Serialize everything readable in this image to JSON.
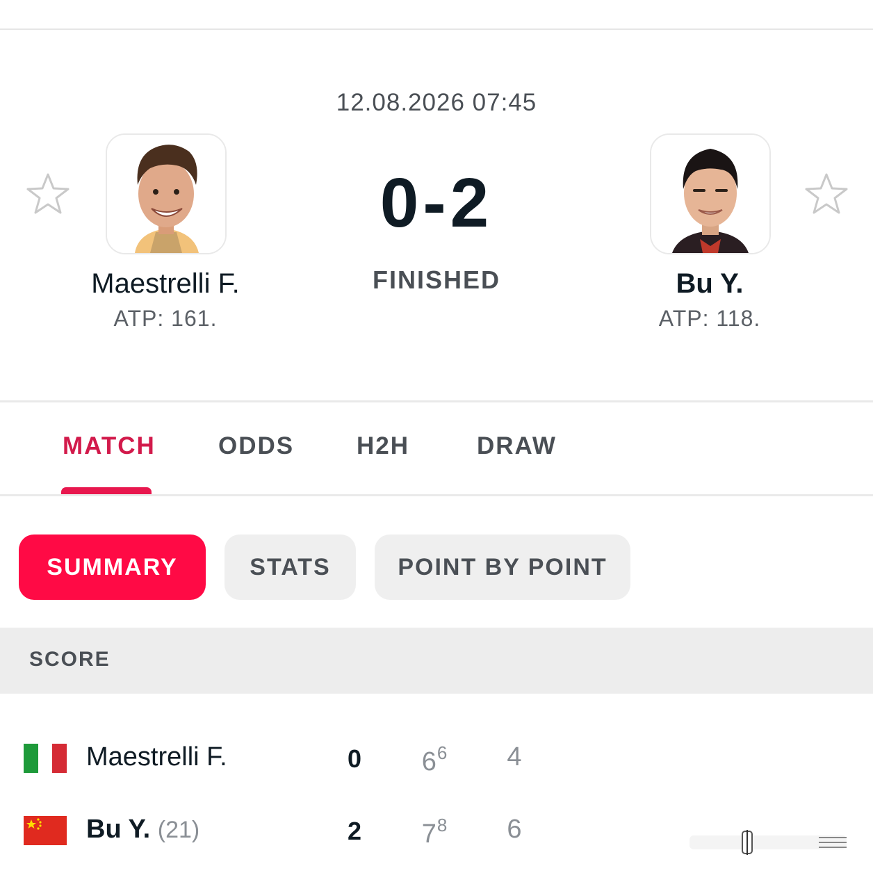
{
  "header": {
    "date_time": "12.08.2026 07:45",
    "score": "0-2",
    "status": "FINISHED"
  },
  "home_player": {
    "name": "Maestrelli F.",
    "rank": "ATP: 161.",
    "favorite_icon": "star-outline-icon"
  },
  "away_player": {
    "name": "Bu Y.",
    "rank": "ATP: 118.",
    "favorite_icon": "star-outline-icon"
  },
  "tabs": [
    {
      "label": "MATCH",
      "active": true
    },
    {
      "label": "ODDS",
      "active": false
    },
    {
      "label": "H2H",
      "active": false
    },
    {
      "label": "DRAW",
      "active": false
    }
  ],
  "subtabs": [
    {
      "label": "SUMMARY",
      "active": true
    },
    {
      "label": "STATS",
      "active": false
    },
    {
      "label": "POINT BY POINT",
      "active": false
    }
  ],
  "score_section": {
    "title": "SCORE",
    "rows": [
      {
        "name": "Maestrelli F.",
        "seed": "",
        "flag": "italy-flag-icon",
        "sets_won": "0",
        "set1": "6",
        "set1_tiebreak": "6",
        "set2": "4",
        "winner": false
      },
      {
        "name": "Bu Y.",
        "seed": "(21)",
        "flag": "china-flag-icon",
        "sets_won": "2",
        "set1": "7",
        "set1_tiebreak": "8",
        "set2": "6",
        "winner": true
      }
    ]
  },
  "colors": {
    "accent": "#ff0a45",
    "active_tab": "#d21a4b",
    "text_dark": "#0f1b24",
    "text_muted": "#4a4f55"
  }
}
